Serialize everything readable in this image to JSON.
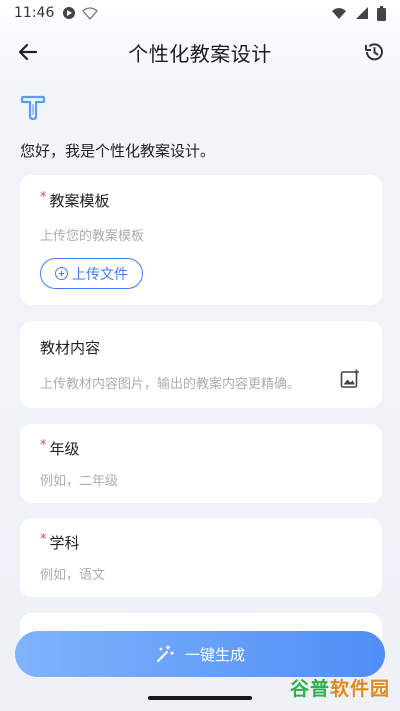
{
  "status_bar": {
    "time": "11:46"
  },
  "app_bar": {
    "title": "个性化教案设计"
  },
  "greeting": "您好，我是个性化教案设计。",
  "template_card": {
    "required_mark": "*",
    "label": "教案模板",
    "placeholder": "上传您的教案模板",
    "upload_label": "上传文件"
  },
  "material_card": {
    "label": "教材内容",
    "placeholder": "上传教材内容图片，输出的教案内容更精确。"
  },
  "grade_card": {
    "required_mark": "*",
    "label": "年级",
    "placeholder": "例如，二年级"
  },
  "subject_card": {
    "required_mark": "*",
    "label": "学科",
    "placeholder": "例如，语文"
  },
  "generate_button": {
    "label": "一键生成"
  },
  "watermark": {
    "part1": "谷普",
    "part2": "软件园"
  },
  "colors": {
    "accent": "#3f7df6",
    "required": "#e5484d",
    "button_start": "#7fb4fb",
    "button_end": "#4f8ef7"
  },
  "icons": [
    "back-arrow-icon",
    "history-icon",
    "app-logo-icon",
    "plus-circle-icon",
    "image-add-icon",
    "magic-wand-icon"
  ]
}
